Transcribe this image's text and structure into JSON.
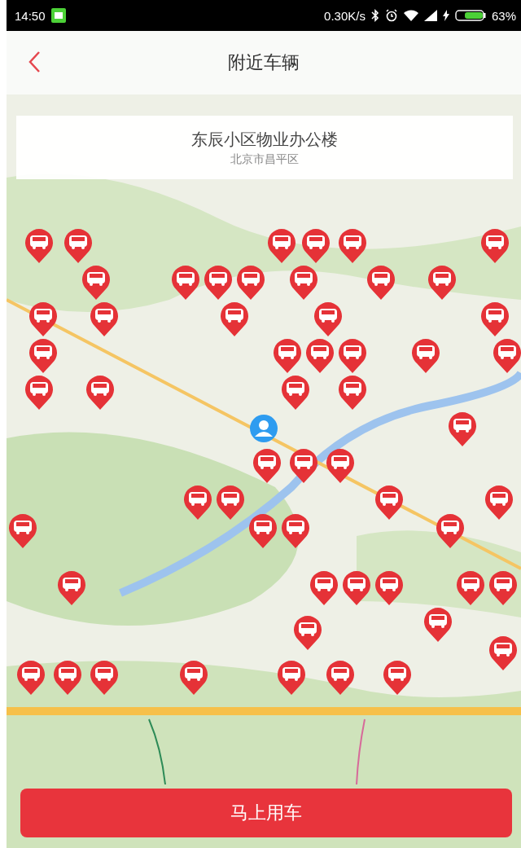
{
  "status_bar": {
    "time": "14:50",
    "network_speed": "0.30K/s",
    "battery": "63%"
  },
  "header": {
    "title": "附近车辆"
  },
  "location_card": {
    "name": "东辰小区物业办公楼",
    "district": "北京市昌平区"
  },
  "action_button": {
    "label": "马上用车"
  }
}
